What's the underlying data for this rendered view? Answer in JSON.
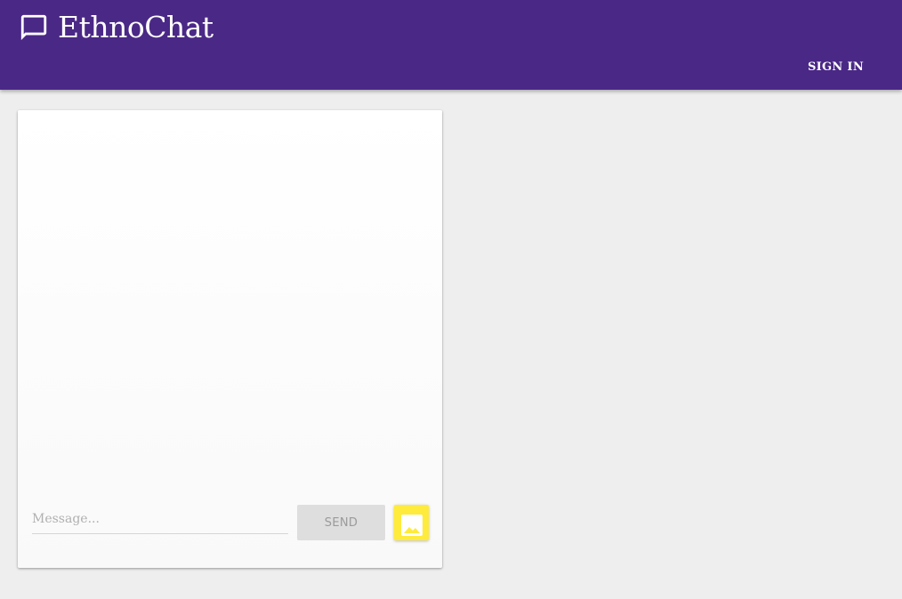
{
  "header": {
    "app_title": "EthnoChat",
    "logo_icon": "chat-bubble-icon",
    "sign_in_label": "SIGN IN",
    "background_color": "#4a2886",
    "text_color": "#ffffff"
  },
  "chat": {
    "messages": [],
    "message_input": {
      "value": "",
      "placeholder": "Message..."
    },
    "send_label": "SEND",
    "send_enabled": false,
    "image_button_icon": "image-icon",
    "image_button_color": "#ffeb3b"
  },
  "page": {
    "background_color": "#eeeeee"
  }
}
